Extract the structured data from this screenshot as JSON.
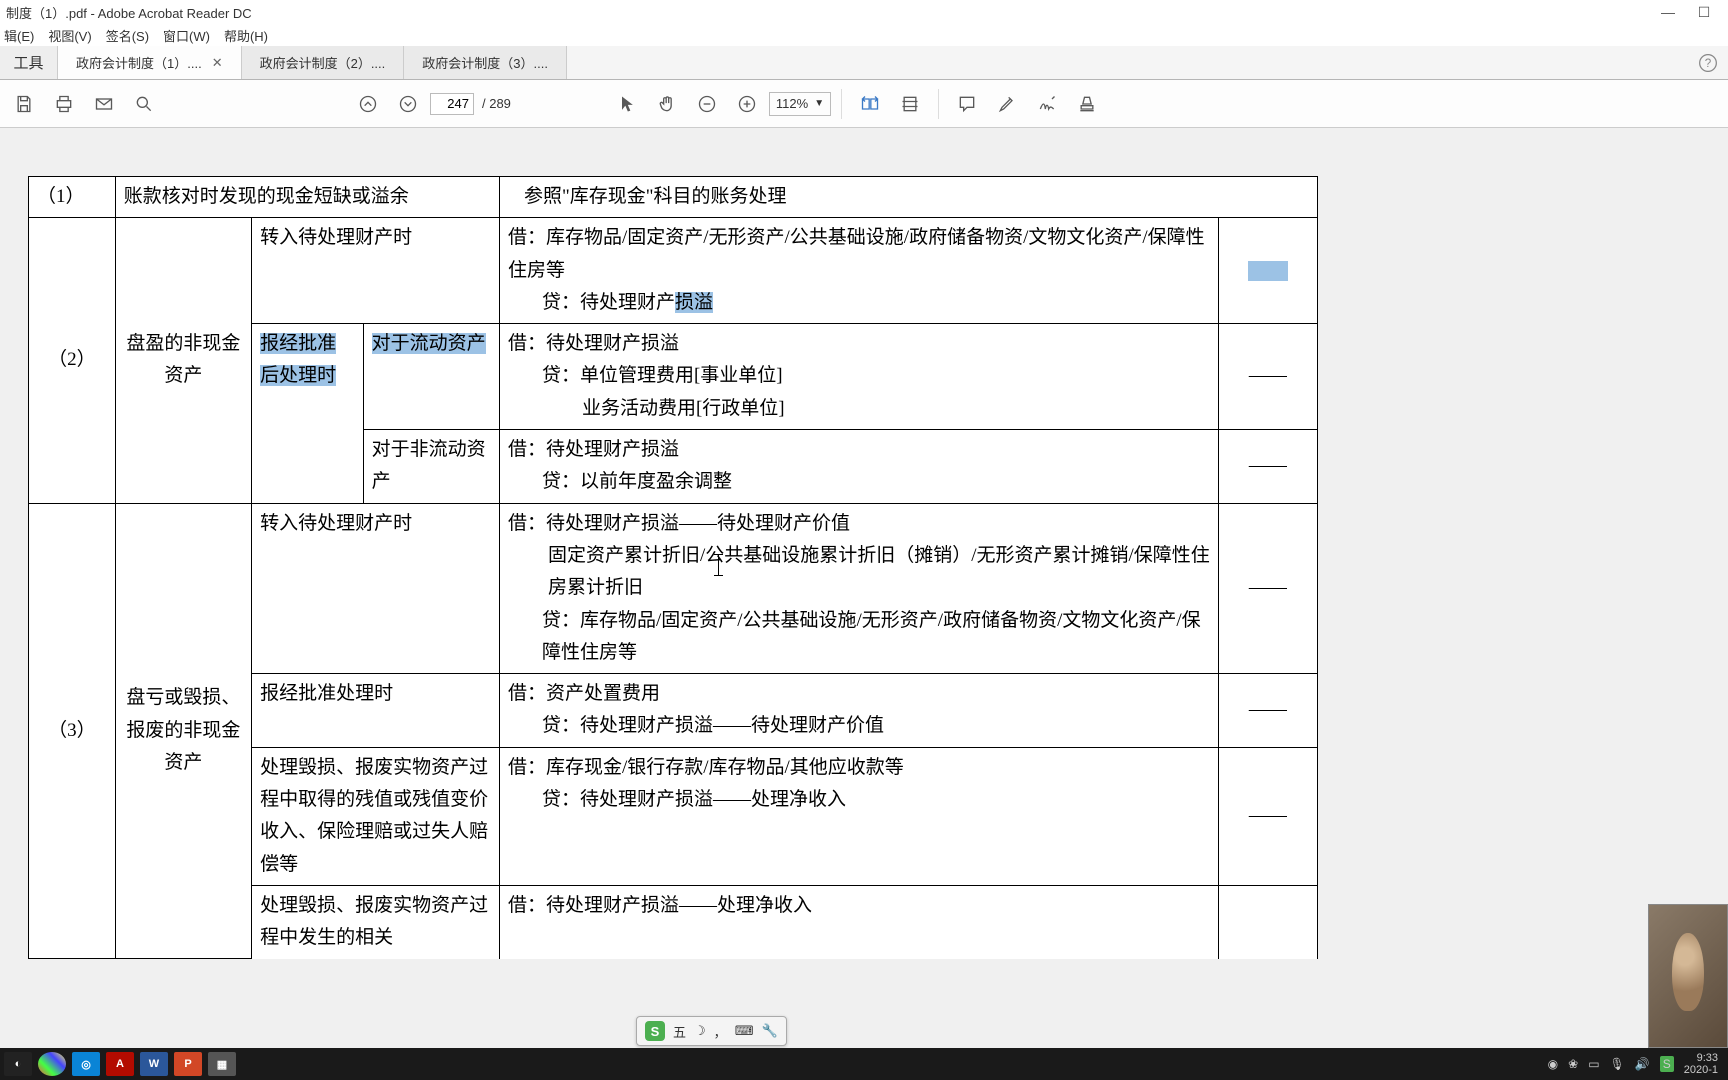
{
  "window": {
    "title": "制度（1）.pdf - Adobe Acrobat Reader DC"
  },
  "menu": {
    "edit": "辑(E)",
    "view": "视图(V)",
    "sign": "签名(S)",
    "window": "窗口(W)",
    "help": "帮助(H)"
  },
  "tabs": {
    "tools": "工具",
    "t1": "政府会计制度（1）....",
    "t2": "政府会计制度（2）....",
    "t3": "政府会计制度（3）...."
  },
  "toolbar": {
    "page_current": "247",
    "page_total": "/ 289",
    "zoom": "112%"
  },
  "table": {
    "r1c1": "（1）",
    "r1c2": "账款核对时发现的现金短缺或溢余",
    "r1c3": "参照\"库存现金\"科目的账务处理",
    "r2_num": "（2）",
    "r2_cat": "盘盈的非现金资产",
    "r2a_step": "转入待处理财产时",
    "r2a_body": "借：库存物品/固定资产/无形资产/公共基础设施/政府储备物资/文物文化资产/保障性住房等",
    "r2a_body2": "贷：待处理财产",
    "r2a_hl": "损溢",
    "r2b_step": "报经批准后处理时",
    "r2b_cond": "对于流动资产",
    "r2b_body": "借：待处理财产损溢",
    "r2b_body2": "贷：单位管理费用[事业单位]",
    "r2b_body3": "业务活动费用[行政单位]",
    "r2b_dash": "——",
    "r2c_cond": "对于非流动资产",
    "r2c_body": "借：待处理财产损溢",
    "r2c_body2": "贷：以前年度盈余调整",
    "r2c_dash": "——",
    "r3_num": "（3）",
    "r3_cat": "盘亏或毁损、报废的非现金资产",
    "r3a_step": "转入待处理财产时",
    "r3a_body": "借：待处理财产损溢——待处理财产价值",
    "r3a_body2": "固定资产累计折旧/公共基础设施累计折旧（摊销）/无形资产累计摊销/保障性住房累计折旧",
    "r3a_body3": "贷：库存物品/固定资产/公共基础设施/无形资产/政府储备物资/文物文化资产/保障性住房等",
    "r3a_dash": "——",
    "r3b_step": "报经批准处理时",
    "r3b_body": "借：资产处置费用",
    "r3b_body2": "贷：待处理财产损溢——待处理财产价值",
    "r3b_dash": "——",
    "r3c_step": "处理毁损、报废实物资产过程中取得的残值或残值变价收入、保险理赔或过失人赔偿等",
    "r3c_body": "借：库存现金/银行存款/库存物品/其他应收款等",
    "r3c_body2": "贷：待处理财产损溢——处理净收入",
    "r3c_dash": "——",
    "r3d_step": "处理毁损、报废实物资产过程中发生的相关",
    "r3d_body": "借：待处理财产损溢——处理净收入"
  },
  "ime": {
    "label": "五",
    "moon": "☽",
    "comma": "，",
    "keyboard": "⌨",
    "spanner": "🔧"
  },
  "tray": {
    "time": "9:33",
    "date": "2020-1"
  }
}
